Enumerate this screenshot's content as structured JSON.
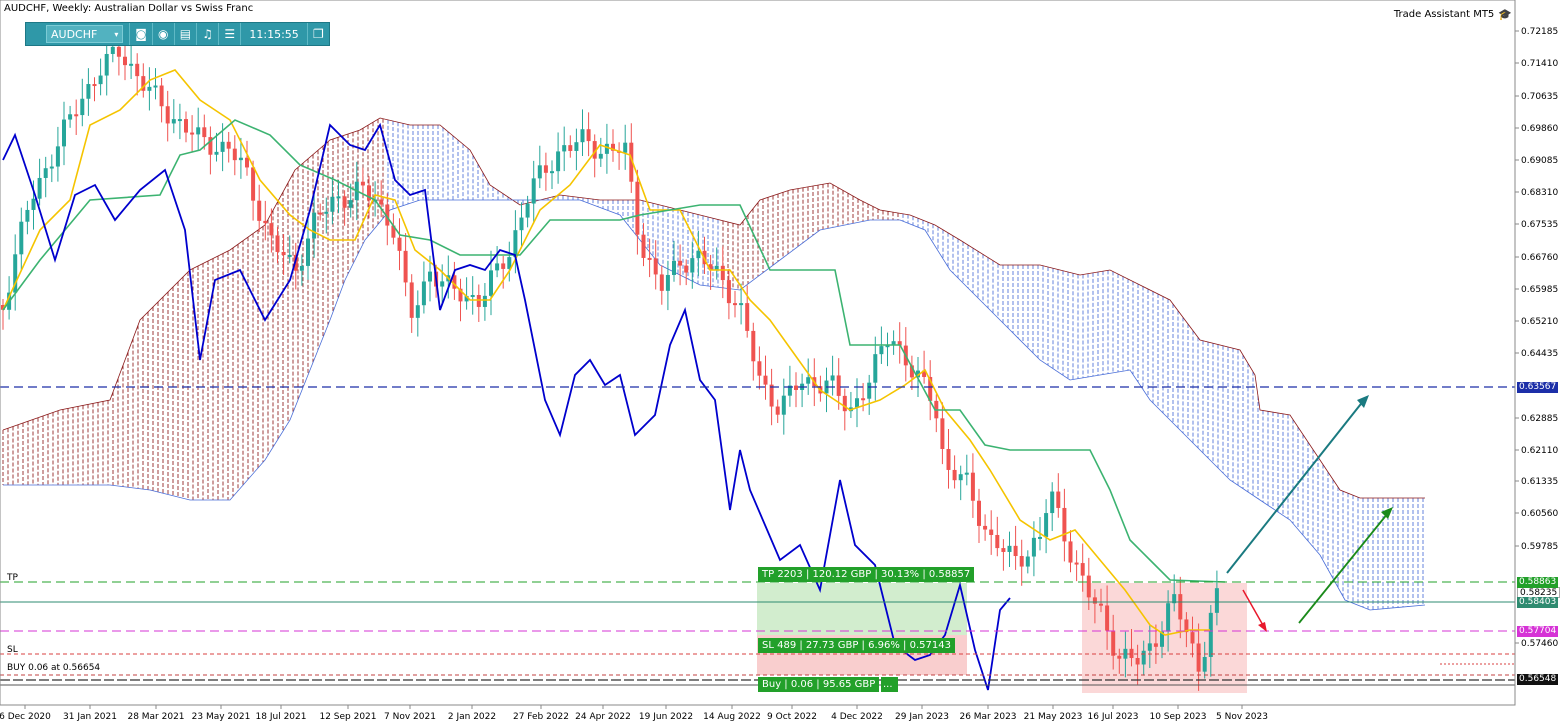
{
  "title": "AUDCHF, Weekly:  Australian Dollar vs Swiss Franc",
  "toolbar": {
    "symbol": "AUDCHF",
    "time": "11:15:55",
    "icons": [
      "camera-icon",
      "eye-icon",
      "calendar-icon",
      "bell-icon",
      "menu-icon",
      "window-icon"
    ]
  },
  "assistant_label": "Trade Assistant MT5",
  "y_ticks": [
    "0.72185",
    "0.71410",
    "0.70635",
    "0.69860",
    "0.69085",
    "0.68310",
    "0.67535",
    "0.66760",
    "0.65985",
    "0.65210",
    "0.64435",
    "0.62885",
    "0.62110",
    "0.61335",
    "0.60560",
    "0.59785",
    "0.57460"
  ],
  "x_ticks": [
    "6 Dec 2020",
    "31 Jan 2021",
    "28 Mar 2021",
    "23 May 2021",
    "18 Jul 2021",
    "12 Sep 2021",
    "7 Nov 2021",
    "2 Jan 2022",
    "27 Feb 2022",
    "24 Apr 2022",
    "19 Jun 2022",
    "14 Aug 2022",
    "9 Oct 2022",
    "4 Dec 2022",
    "29 Jan 2023",
    "26 Mar 2023",
    "21 May 2023",
    "16 Jul 2023",
    "10 Sep 2023",
    "5 Nov 2023"
  ],
  "levels": {
    "tp_label": "TP",
    "sl_label": "SL",
    "buy_label": "BUY 0.06 at 0.56654",
    "tp_box": "TP 2203 | 120.12 GBP | 30.13% | 0.58857",
    "sl_box": "SL 489 | 27.73 GBP | 6.96% | 0.57143",
    "buy_box": "Buy | 0.06 | 95.65 GBP",
    "buy_box_extra": "..."
  },
  "price_tags": {
    "resistance": "0.63567",
    "tp": "0.58863",
    "current": "0.58403",
    "sl": "0.57704",
    "buy": "0.56548",
    "bid": "0.58235"
  },
  "colors": {
    "bull": "#26a69a",
    "bear": "#ef5350",
    "tenkan": "#f5c400",
    "kijun": "#3cb371",
    "chikou": "#0000cd",
    "kumo_bull": "#4a6ed8",
    "kumo_bear": "#8b1a1a",
    "tp_green": "#22a02a",
    "sl_pink": "#d633d6"
  }
}
